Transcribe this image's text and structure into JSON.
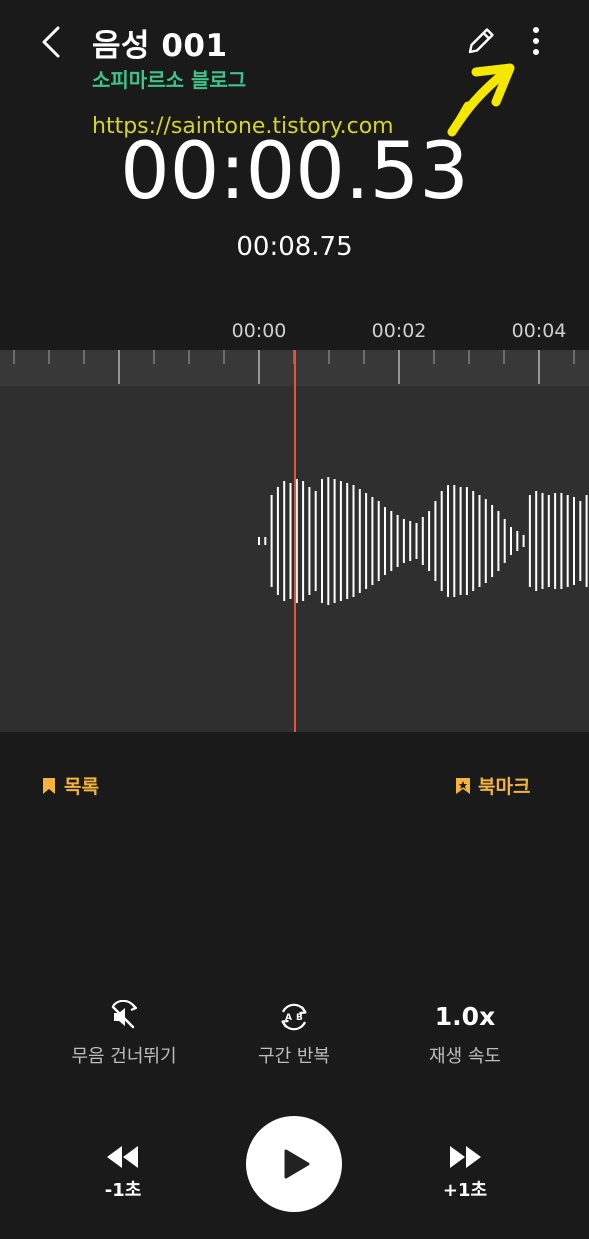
{
  "header": {
    "title": "음성 001",
    "back_icon": "chevron-left-icon",
    "edit_icon": "pencil-icon",
    "more_icon": "more-vertical-icon"
  },
  "watermark": {
    "blog_name": "소피마르소 블로그",
    "url": "https://saintone.tistory.com",
    "blog_color": "#3fc38a",
    "url_color": "#d4d32a"
  },
  "annotation": {
    "arrow_color": "#f5e800"
  },
  "playback": {
    "elapsed": "00:00.53",
    "total": "00:08.75"
  },
  "timeline": {
    "tick_labels": [
      "00:00",
      "00:02",
      "00:04"
    ],
    "playhead_color": "#e5533d"
  },
  "bookmarks": {
    "list_label": "목록",
    "add_label": "북마크",
    "accent": "#f3b33d"
  },
  "controls": {
    "skip_silence": {
      "label": "무음 건너뛰기",
      "icon": "mute-skip-icon"
    },
    "repeat_ab": {
      "label": "구간 반복",
      "icon": "repeat-ab-icon"
    },
    "speed": {
      "value": "1.0x",
      "label": "재생 속도"
    }
  },
  "transport": {
    "rewind_label": "-1초",
    "forward_label": "+1초",
    "play_icon": "play-icon"
  }
}
